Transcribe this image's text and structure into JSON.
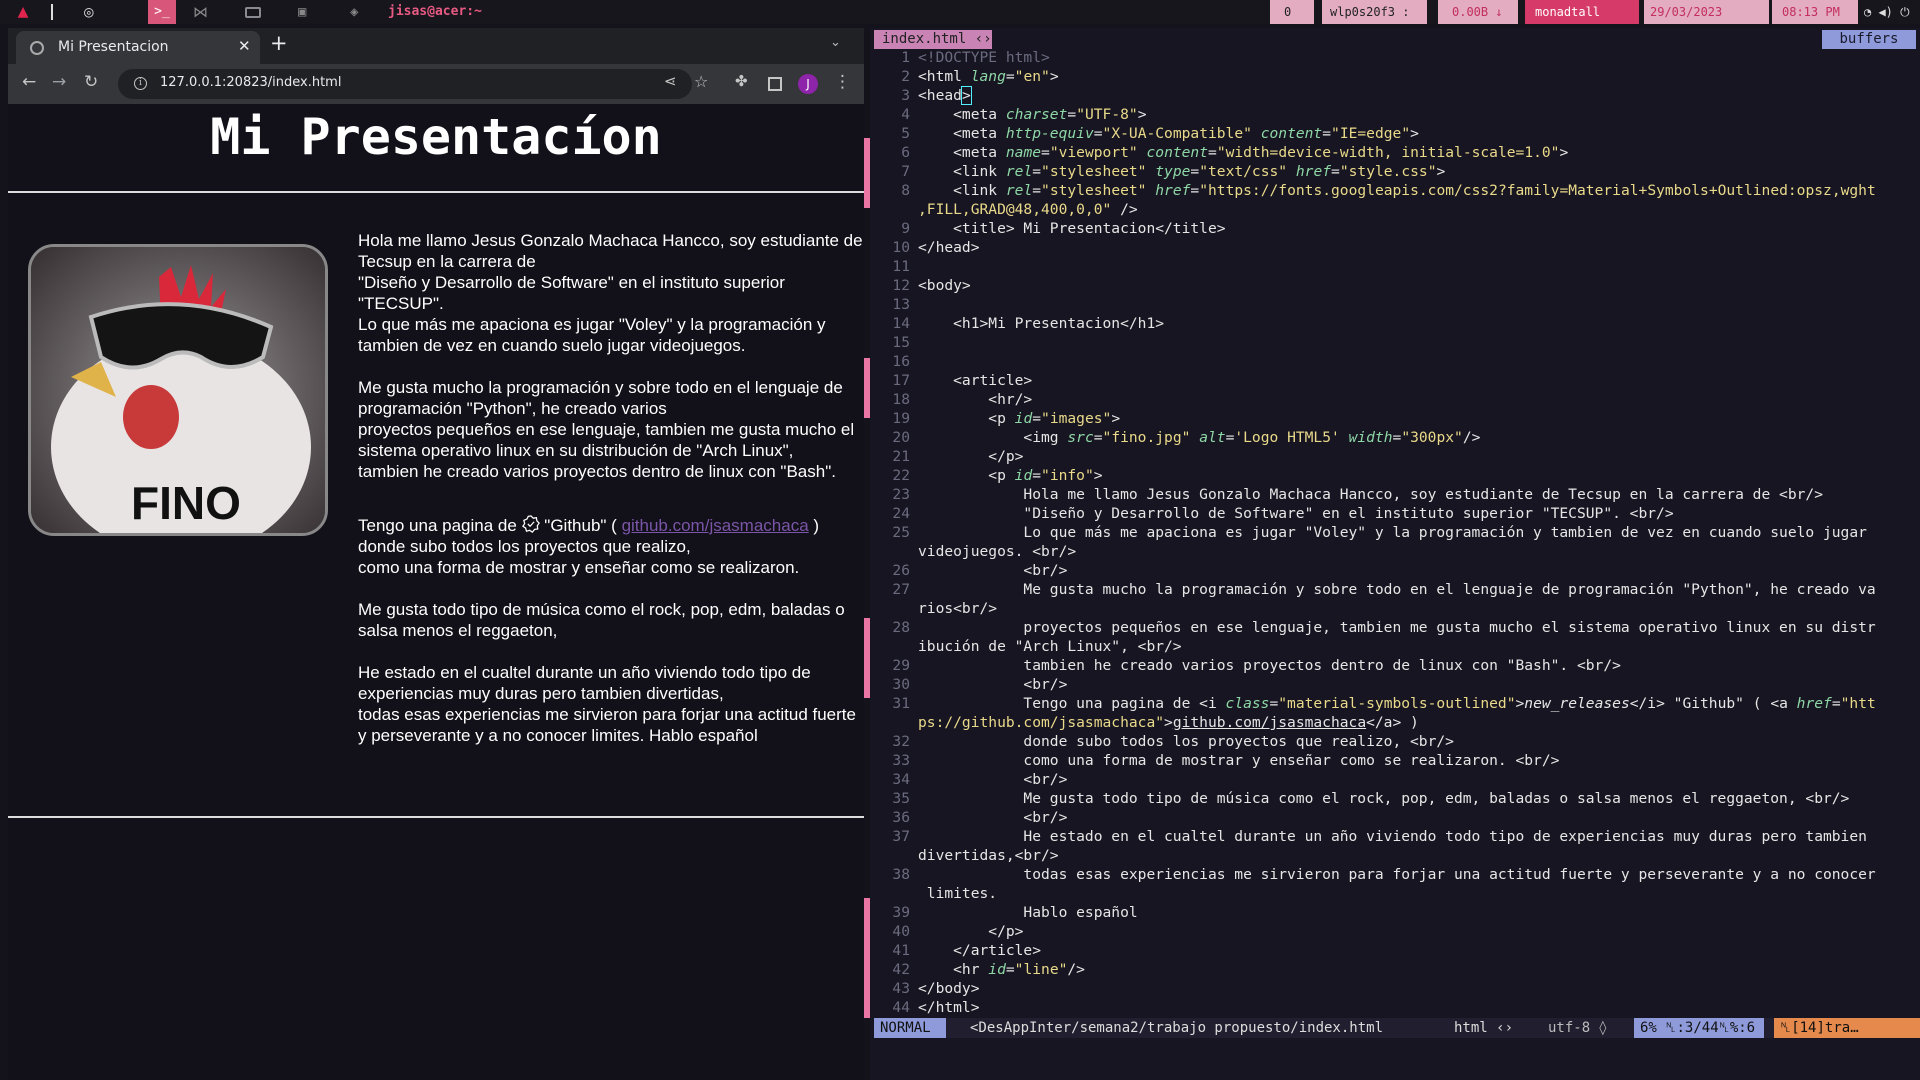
{
  "topbar": {
    "arch_icon": "▲",
    "window_title": "jisas@acer:~",
    "pkg_count": "0",
    "wifi": "wlp0s20f3 :",
    "net_speed": "0.00B ↓",
    "updates": "monadtall",
    "date": "29/03/2023",
    "time": "08:13 PM"
  },
  "browser": {
    "tab_title": "Mi Presentacion",
    "url": "127.0.0.1:20823/index.html",
    "avatar": "J"
  },
  "page": {
    "h1": "Mi Presentacíon",
    "photo_caption": "FINO",
    "info": {
      "l1": "Hola me llamo Jesus Gonzalo Machaca Hancco, soy estudiante de Tecsup en la carrera de",
      "l2": "\"Diseño y Desarrollo de Software\" en el instituto superior \"TECSUP\".",
      "l3": "Lo que más me apaciona es jugar \"Voley\" y la programación y tambien de vez en cuando suelo jugar videojuegos.",
      "l4": "Me gusta mucho la programación y sobre todo en el lenguaje de programación \"Python\", he creado varios",
      "l5": "proyectos pequeños en ese lenguaje, tambien me gusta mucho el sistema operativo linux en su distribución de \"Arch Linux\",",
      "l6": "tambien he creado varios proyectos dentro de linux con \"Bash\".",
      "l7a": "Tengo una pagina de",
      "l7b": "\"Github\" (",
      "l7link": "github.com/jsasmachaca",
      "l7c": ")",
      "l8": "donde subo todos los proyectos que realizo,",
      "l9": "como una forma de mostrar y enseñar como se realizaron.",
      "l10": "Me gusta todo tipo de música como el rock, pop, edm, baladas o salsa menos el reggaeton,",
      "l11": "He estado en el cualtel durante un año viviendo todo tipo de experiencias muy duras pero tambien divertidas,",
      "l12": "todas esas experiencias me sirvieron para forjar una actitud fuerte y perseverante y a no conocer limites. Hablo español"
    }
  },
  "editor": {
    "tab": "index.html ‹›",
    "buffers": "buffers",
    "status": {
      "mode": "NORMAL",
      "path": "<DesAppInter/semana2/trabajo propuesto/index.html",
      "ftype": "html ‹›",
      "enc": "utf-8 ◊",
      "pct": "6% ␤:3/44␤%:6",
      "misc": "␤[14]tra…"
    }
  }
}
